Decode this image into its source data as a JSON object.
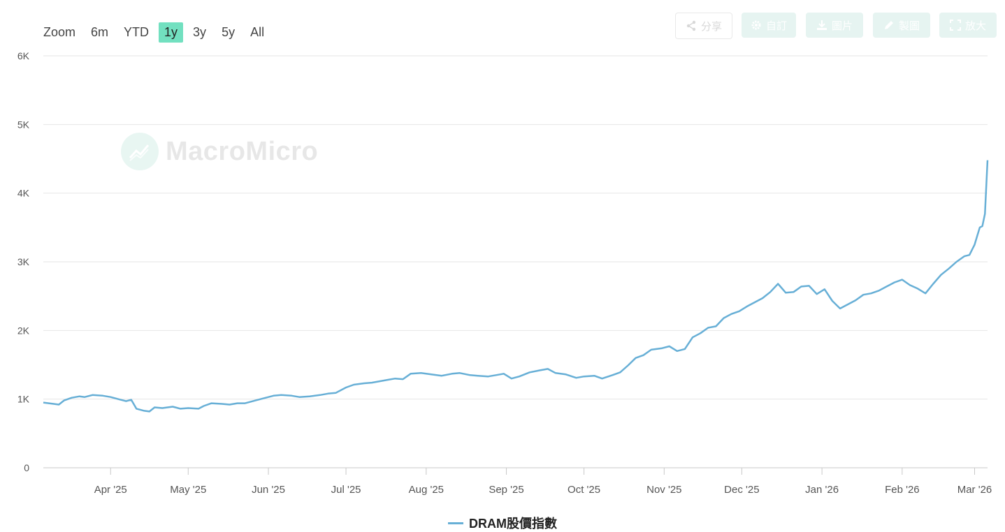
{
  "zoom": {
    "label": "Zoom",
    "options": [
      "6m",
      "YTD",
      "1y",
      "3y",
      "5y",
      "All"
    ],
    "active": "1y"
  },
  "toolbar": {
    "share": "分享",
    "customize": "自訂",
    "image": "圖片",
    "draw": "製圖",
    "zoom": "放大"
  },
  "watermark": "MacroMicro",
  "colors": {
    "series": "#67afd6",
    "active_zoom": "#72e0c0",
    "grid": "#e6e6e6"
  },
  "chart_data": {
    "type": "line",
    "title": "",
    "xlabel": "",
    "ylabel": "",
    "ylim": [
      0,
      6000
    ],
    "yticks": [
      0,
      1000,
      2000,
      3000,
      4000,
      5000,
      6000
    ],
    "ytick_labels": [
      "0",
      "1K",
      "2K",
      "3K",
      "4K",
      "5K",
      "6K"
    ],
    "x_range": [
      "2025-03-06",
      "2026-03-06"
    ],
    "xticks": [
      {
        "date": "2025-04-01",
        "label": "Apr '25"
      },
      {
        "date": "2025-05-01",
        "label": "May '25"
      },
      {
        "date": "2025-06-01",
        "label": "Jun '25"
      },
      {
        "date": "2025-07-01",
        "label": "Jul '25"
      },
      {
        "date": "2025-08-01",
        "label": "Aug '25"
      },
      {
        "date": "2025-09-01",
        "label": "Sep '25"
      },
      {
        "date": "2025-10-01",
        "label": "Oct '25"
      },
      {
        "date": "2025-11-01",
        "label": "Nov '25"
      },
      {
        "date": "2025-12-01",
        "label": "Dec '25"
      },
      {
        "date": "2026-01-01",
        "label": "Jan '26"
      },
      {
        "date": "2026-02-01",
        "label": "Feb '26"
      },
      {
        "date": "2026-03-01",
        "label": "Mar '26"
      }
    ],
    "grid": true,
    "legend": "bottom-center",
    "series": [
      {
        "name": "DRAM股價指數",
        "points": [
          [
            "2025-03-06",
            950
          ],
          [
            "2025-03-10",
            930
          ],
          [
            "2025-03-12",
            920
          ],
          [
            "2025-03-14",
            980
          ],
          [
            "2025-03-17",
            1020
          ],
          [
            "2025-03-20",
            1040
          ],
          [
            "2025-03-22",
            1030
          ],
          [
            "2025-03-25",
            1060
          ],
          [
            "2025-03-29",
            1050
          ],
          [
            "2025-04-01",
            1030
          ],
          [
            "2025-04-04",
            1000
          ],
          [
            "2025-04-07",
            970
          ],
          [
            "2025-04-09",
            990
          ],
          [
            "2025-04-11",
            860
          ],
          [
            "2025-04-14",
            830
          ],
          [
            "2025-04-16",
            820
          ],
          [
            "2025-04-18",
            880
          ],
          [
            "2025-04-21",
            870
          ],
          [
            "2025-04-25",
            890
          ],
          [
            "2025-04-28",
            860
          ],
          [
            "2025-05-01",
            870
          ],
          [
            "2025-05-05",
            860
          ],
          [
            "2025-05-07",
            900
          ],
          [
            "2025-05-10",
            940
          ],
          [
            "2025-05-14",
            930
          ],
          [
            "2025-05-17",
            920
          ],
          [
            "2025-05-20",
            940
          ],
          [
            "2025-05-23",
            940
          ],
          [
            "2025-05-27",
            980
          ],
          [
            "2025-05-31",
            1020
          ],
          [
            "2025-06-03",
            1050
          ],
          [
            "2025-06-06",
            1060
          ],
          [
            "2025-06-10",
            1050
          ],
          [
            "2025-06-13",
            1030
          ],
          [
            "2025-06-17",
            1040
          ],
          [
            "2025-06-21",
            1060
          ],
          [
            "2025-06-24",
            1080
          ],
          [
            "2025-06-27",
            1090
          ],
          [
            "2025-07-01",
            1170
          ],
          [
            "2025-07-04",
            1210
          ],
          [
            "2025-07-08",
            1230
          ],
          [
            "2025-07-11",
            1240
          ],
          [
            "2025-07-14",
            1260
          ],
          [
            "2025-07-17",
            1280
          ],
          [
            "2025-07-20",
            1300
          ],
          [
            "2025-07-23",
            1290
          ],
          [
            "2025-07-26",
            1370
          ],
          [
            "2025-07-30",
            1380
          ],
          [
            "2025-08-03",
            1360
          ],
          [
            "2025-08-07",
            1340
          ],
          [
            "2025-08-11",
            1370
          ],
          [
            "2025-08-14",
            1380
          ],
          [
            "2025-08-18",
            1350
          ],
          [
            "2025-08-21",
            1340
          ],
          [
            "2025-08-25",
            1330
          ],
          [
            "2025-08-28",
            1350
          ],
          [
            "2025-08-31",
            1370
          ],
          [
            "2025-09-03",
            1300
          ],
          [
            "2025-09-06",
            1330
          ],
          [
            "2025-09-10",
            1390
          ],
          [
            "2025-09-14",
            1420
          ],
          [
            "2025-09-17",
            1440
          ],
          [
            "2025-09-20",
            1380
          ],
          [
            "2025-09-24",
            1360
          ],
          [
            "2025-09-28",
            1310
          ],
          [
            "2025-10-01",
            1330
          ],
          [
            "2025-10-05",
            1340
          ],
          [
            "2025-10-08",
            1300
          ],
          [
            "2025-10-12",
            1350
          ],
          [
            "2025-10-15",
            1390
          ],
          [
            "2025-10-18",
            1490
          ],
          [
            "2025-10-21",
            1600
          ],
          [
            "2025-10-24",
            1640
          ],
          [
            "2025-10-27",
            1720
          ],
          [
            "2025-10-31",
            1740
          ],
          [
            "2025-11-03",
            1770
          ],
          [
            "2025-11-06",
            1700
          ],
          [
            "2025-11-09",
            1730
          ],
          [
            "2025-11-12",
            1900
          ],
          [
            "2025-11-15",
            1960
          ],
          [
            "2025-11-18",
            2040
          ],
          [
            "2025-11-21",
            2060
          ],
          [
            "2025-11-24",
            2180
          ],
          [
            "2025-11-27",
            2240
          ],
          [
            "2025-11-30",
            2280
          ],
          [
            "2025-12-03",
            2350
          ],
          [
            "2025-12-06",
            2410
          ],
          [
            "2025-12-09",
            2470
          ],
          [
            "2025-12-12",
            2560
          ],
          [
            "2025-12-15",
            2680
          ],
          [
            "2025-12-18",
            2550
          ],
          [
            "2025-12-21",
            2560
          ],
          [
            "2025-12-24",
            2640
          ],
          [
            "2025-12-27",
            2650
          ],
          [
            "2025-12-30",
            2530
          ],
          [
            "2026-01-02",
            2600
          ],
          [
            "2026-01-05",
            2430
          ],
          [
            "2026-01-08",
            2320
          ],
          [
            "2026-01-11",
            2380
          ],
          [
            "2026-01-14",
            2440
          ],
          [
            "2026-01-17",
            2520
          ],
          [
            "2026-01-20",
            2540
          ],
          [
            "2026-01-23",
            2580
          ],
          [
            "2026-01-26",
            2640
          ],
          [
            "2026-01-29",
            2700
          ],
          [
            "2026-02-01",
            2740
          ],
          [
            "2026-02-04",
            2660
          ],
          [
            "2026-02-07",
            2610
          ],
          [
            "2026-02-10",
            2540
          ],
          [
            "2026-02-13",
            2680
          ],
          [
            "2026-02-16",
            2810
          ],
          [
            "2026-02-19",
            2900
          ],
          [
            "2026-02-22",
            3000
          ],
          [
            "2026-02-25",
            3080
          ],
          [
            "2026-02-27",
            3100
          ],
          [
            "2026-03-01",
            3250
          ],
          [
            "2026-03-03",
            3500
          ],
          [
            "2026-03-04",
            3520
          ],
          [
            "2026-03-05",
            3700
          ],
          [
            "2026-03-06",
            4480
          ]
        ]
      }
    ]
  }
}
